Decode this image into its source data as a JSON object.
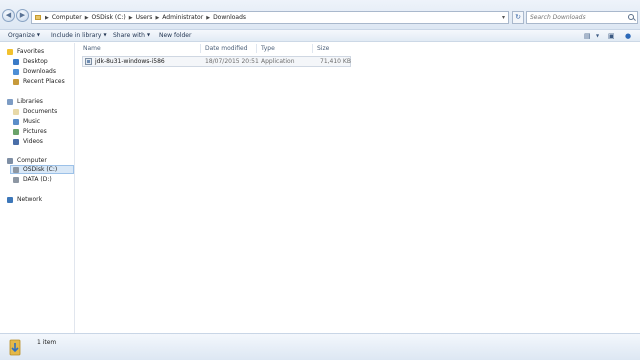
{
  "address_bar": {
    "breadcrumbs": [
      "Computer",
      "OSDisk (C:)",
      "Users",
      "Administrator",
      "Downloads"
    ],
    "search_placeholder": "Search Downloads"
  },
  "toolbar": {
    "organize": "Organize",
    "include_in_library": "Include in library",
    "share_with": "Share with",
    "new_folder": "New folder"
  },
  "navigation": {
    "favorites": {
      "label": "Favorites",
      "items": [
        "Desktop",
        "Downloads",
        "Recent Places"
      ]
    },
    "libraries": {
      "label": "Libraries",
      "items": [
        "Documents",
        "Music",
        "Pictures",
        "Videos"
      ]
    },
    "computer": {
      "label": "Computer",
      "items": [
        "OSDisk (C:)",
        "DATA (D:)"
      ],
      "selected": "OSDisk (C:)"
    },
    "network": {
      "label": "Network"
    }
  },
  "file_list": {
    "columns": [
      "Name",
      "Date modified",
      "Type",
      "Size"
    ],
    "rows": [
      {
        "name": "jdk-8u31-windows-i586",
        "date_modified": "18/07/2015 20:51",
        "type": "Application",
        "size": "71,410 KB"
      }
    ]
  },
  "status": {
    "text": "1 item"
  },
  "colors": {
    "selection": "#d9e8f7",
    "accent": "#3d6aa8"
  }
}
